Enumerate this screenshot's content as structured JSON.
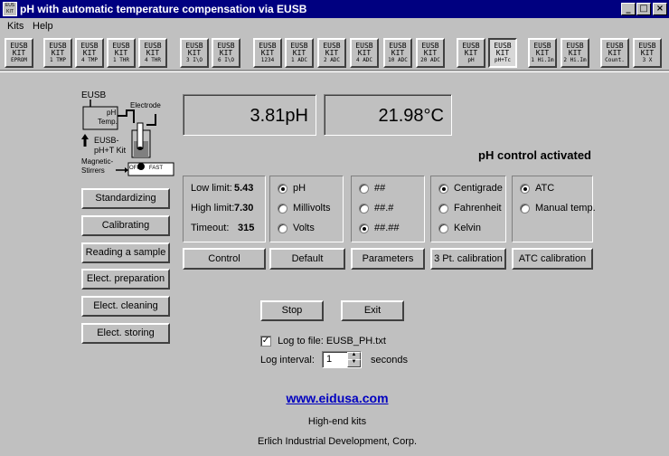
{
  "window": {
    "title": "pH with automatic temperature compensation via EUSB",
    "icon_lines": [
      "EUS",
      "KIT",
      "B"
    ],
    "minimize_glyph": "_",
    "maximize_glyph": "□",
    "close_glyph": "×"
  },
  "menu": [
    {
      "label": "Kits"
    },
    {
      "label": "Help"
    }
  ],
  "toolbar": [
    {
      "l1": "EUSB",
      "l2": "KIT",
      "l3": "EPROM"
    },
    {
      "l1": "EUSB",
      "l2": "KIT",
      "l3": "1 TMP"
    },
    {
      "l1": "EUSB",
      "l2": "KIT",
      "l3": "4 TMP"
    },
    {
      "l1": "EUSB",
      "l2": "KIT",
      "l3": "1 THR"
    },
    {
      "l1": "EUSB",
      "l2": "KIT",
      "l3": "4 THR"
    },
    {
      "l1": "EUSB",
      "l2": "KIT",
      "l3": "3 I\\O"
    },
    {
      "l1": "EUSB",
      "l2": "KIT",
      "l3": "6 I\\O"
    },
    {
      "l1": "EUSB",
      "l2": "KIT",
      "l3": "1234"
    },
    {
      "l1": "EUSB",
      "l2": "KIT",
      "l3": "1 ADC"
    },
    {
      "l1": "EUSB",
      "l2": "KIT",
      "l3": "2 ADC"
    },
    {
      "l1": "EUSB",
      "l2": "KIT",
      "l3": "4 ADC"
    },
    {
      "l1": "EUSB",
      "l2": "KIT",
      "l3": "10 ADC"
    },
    {
      "l1": "EUSB",
      "l2": "KIT",
      "l3": "20 ADC"
    },
    {
      "l1": "EUSB",
      "l2": "KIT",
      "l3": "pH"
    },
    {
      "l1": "EUSB",
      "l2": "KIT",
      "l3": "pH+Tc"
    },
    {
      "l1": "EUSB",
      "l2": "KIT",
      "l3": "1 Hi.Im"
    },
    {
      "l1": "EUSB",
      "l2": "KIT",
      "l3": "2 Hi.Im"
    },
    {
      "l1": "EUSB",
      "l2": "KIT",
      "l3": "Count."
    },
    {
      "l1": "EUSB",
      "l2": "KIT",
      "l3": "3 X"
    }
  ],
  "diagram": {
    "eusb": "EUSB",
    "ph": "pH",
    "temp": "Temp.",
    "electrode": "Electrode",
    "kit_line1": "EUSB-",
    "kit_line2": "pH+T Kit",
    "magnetic": "Magnetic-",
    "stirrers": "Stirrers",
    "off": "OFF",
    "fast": "FAST"
  },
  "readings": {
    "ph": "3.81pH",
    "temperature": "21.98°C"
  },
  "status": "pH control activated",
  "control_group": {
    "low_label": "Low limit:",
    "low_value": "5.43",
    "high_label": "High limit:",
    "high_value": "7.30",
    "timeout_label": "Timeout:",
    "timeout_value": "315"
  },
  "unit_options": [
    "pH",
    "Millivolts",
    "Volts"
  ],
  "format_options": [
    "##",
    "##.#",
    "##.##"
  ],
  "temp_unit_options": [
    "Centigrade",
    "Fahrenheit",
    "Kelvin"
  ],
  "atc_options": [
    "ATC",
    "Manual temp."
  ],
  "selected": {
    "unit": "pH",
    "format": "##.##",
    "temp_unit": "Centigrade",
    "atc": "ATC"
  },
  "group_buttons": [
    "Control",
    "Default",
    "Parameters",
    "3 Pt. calibration",
    "ATC calibration"
  ],
  "side_buttons": [
    "Standardizing",
    "Calibrating",
    "Reading a sample",
    "Elect. preparation",
    "Elect. cleaning",
    "Elect. storing"
  ],
  "stop_label": "Stop",
  "exit_label": "Exit",
  "log": {
    "checked": true,
    "check_mark": "✓",
    "file_label": "Log to file: EUSB_PH.txt",
    "interval_label": "Log interval:",
    "interval_value": "1",
    "interval_unit": "seconds",
    "spin_up": "▲",
    "spin_down": "▼"
  },
  "footer": {
    "link": "www.eidusa.com",
    "tagline": "High-end kits",
    "company": "Erlich Industrial Development, Corp."
  }
}
